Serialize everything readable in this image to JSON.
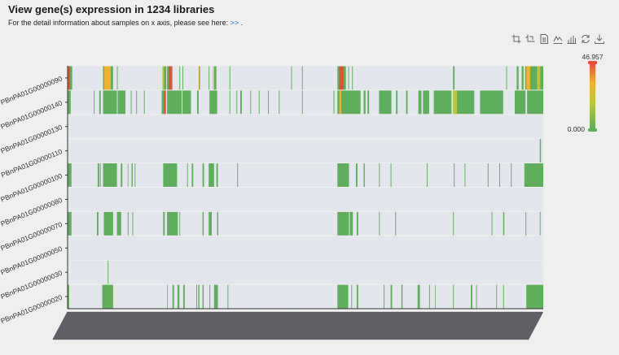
{
  "header": {
    "title": "View gene(s) expression in 1234 libraries",
    "subtitle_prefix": "For the detail information about samples on x axis, please see here:",
    "link_text": ">>",
    "subtitle_suffix": "."
  },
  "toolbar": {
    "tools": [
      {
        "icon": "crop-icon"
      },
      {
        "icon": "crop-reset-icon"
      },
      {
        "icon": "data-view-icon"
      },
      {
        "icon": "line-chart-icon"
      },
      {
        "icon": "bar-chart-icon"
      },
      {
        "icon": "refresh-icon"
      },
      {
        "icon": "download-icon"
      }
    ]
  },
  "chart_data": {
    "type": "heatmap",
    "title": "View gene(s) expression in 1234 libraries",
    "n_samples": 1234,
    "rows": [
      "PBnPA01G00000020",
      "PBnPA01G00000030",
      "PBnPA01G00000050",
      "PBnPA01G00000070",
      "PBnPA01G00000080",
      "PBnPA01G00000100",
      "PBnPA01G00000110",
      "PBnPA01G00000130",
      "PBnPA01G00000140",
      "PBnPA01G00000090"
    ],
    "colorbar": {
      "min": 0.0,
      "max": 46.957,
      "min_label": "0.000",
      "max_label": "46.957"
    },
    "colors": {
      "empty": "#e3e6ec",
      "low": "#5fae5c",
      "mid": "#bcc63a",
      "high_mid": "#f0b22e",
      "high": "#ea4c34"
    },
    "expressed_segments": {
      "PBnPA01G00000020": [
        [
          0,
          4
        ],
        [
          90,
          118
        ],
        [
          258,
          259
        ],
        [
          272,
          276
        ],
        [
          285,
          290
        ],
        [
          300,
          304
        ],
        [
          334,
          336
        ],
        [
          339,
          342
        ],
        [
          350,
          353
        ],
        [
          368,
          370
        ],
        [
          380,
          390
        ],
        [
          415,
          417
        ],
        [
          700,
          728
        ],
        [
          736,
          738
        ],
        [
          750,
          754
        ],
        [
          820,
          822
        ],
        [
          838,
          842
        ],
        [
          866,
          869
        ],
        [
          908,
          914
        ],
        [
          938,
          940
        ],
        [
          953,
          954
        ],
        [
          1000,
          1002
        ],
        [
          1046,
          1050
        ],
        [
          1060,
          1062
        ],
        [
          1112,
          1114
        ],
        [
          1130,
          1132
        ],
        [
          1190,
          1234
        ]
      ],
      "PBnPA01G00000030": [
        [
          104,
          106
        ]
      ],
      "PBnPA01G00000050": [],
      "PBnPA01G00000070": [
        [
          0,
          10
        ],
        [
          76,
          80
        ],
        [
          94,
          118
        ],
        [
          128,
          139
        ],
        [
          156,
          158
        ],
        [
          168,
          170
        ],
        [
          248,
          252
        ],
        [
          258,
          286
        ],
        [
          290,
          292
        ],
        [
          350,
          353
        ],
        [
          366,
          374
        ],
        [
          388,
          391
        ],
        [
          700,
          730
        ],
        [
          732,
          740
        ],
        [
          750,
          754
        ],
        [
          808,
          810
        ],
        [
          850,
          852
        ],
        [
          1000,
          1002
        ],
        [
          1100,
          1102
        ],
        [
          1130,
          1133
        ],
        [
          1188,
          1190
        ],
        [
          1225,
          1227
        ]
      ],
      "PBnPA01G00000080": [],
      "PBnPA01G00000100": [
        [
          0,
          10
        ],
        [
          78,
          82
        ],
        [
          84,
          86
        ],
        [
          92,
          128
        ],
        [
          138,
          142
        ],
        [
          156,
          157
        ],
        [
          166,
          169
        ],
        [
          174,
          176
        ],
        [
          248,
          284
        ],
        [
          310,
          312
        ],
        [
          322,
          326
        ],
        [
          350,
          354
        ],
        [
          366,
          380
        ],
        [
          386,
          390
        ],
        [
          440,
          442
        ],
        [
          700,
          730
        ],
        [
          748,
          752
        ],
        [
          768,
          771
        ],
        [
          808,
          810
        ],
        [
          838,
          840
        ],
        [
          932,
          934
        ],
        [
          1002,
          1004
        ],
        [
          1030,
          1032
        ],
        [
          1090,
          1092
        ],
        [
          1120,
          1122
        ],
        [
          1150,
          1152
        ],
        [
          1185,
          1234
        ]
      ],
      "PBnPA01G00000110": [
        [
          1225,
          1228
        ]
      ],
      "PBnPA01G00000130": [],
      "PBnPA01G00000140": [
        [
          0,
          8
        ],
        [
          68,
          70
        ],
        [
          82,
          86
        ],
        [
          92,
          128
        ],
        [
          130,
          150
        ],
        [
          164,
          166
        ],
        [
          178,
          180
        ],
        [
          198,
          200
        ],
        [
          244,
          255
        ],
        [
          258,
          296
        ],
        [
          298,
          320
        ],
        [
          336,
          340
        ],
        [
          368,
          388
        ],
        [
          420,
          422
        ],
        [
          438,
          440
        ],
        [
          448,
          452
        ],
        [
          474,
          476
        ],
        [
          496,
          498
        ],
        [
          520,
          522
        ],
        [
          548,
          550
        ],
        [
          608,
          610
        ],
        [
          690,
          692
        ],
        [
          700,
          760
        ],
        [
          768,
          773
        ],
        [
          778,
          782
        ],
        [
          808,
          840
        ],
        [
          852,
          856
        ],
        [
          878,
          882
        ],
        [
          910,
          918
        ],
        [
          922,
          938
        ],
        [
          950,
          996
        ],
        [
          1000,
          1055
        ],
        [
          1070,
          1130
        ],
        [
          1160,
          1188
        ],
        [
          1192,
          1234
        ]
      ],
      "PBnPA01G00000090": [
        [
          0,
          12
        ],
        [
          92,
          118
        ],
        [
          128,
          130
        ],
        [
          248,
          256
        ],
        [
          258,
          272
        ],
        [
          290,
          292
        ],
        [
          298,
          300
        ],
        [
          340,
          344
        ],
        [
          366,
          368
        ],
        [
          380,
          386
        ],
        [
          420,
          422
        ],
        [
          580,
          582
        ],
        [
          608,
          610
        ],
        [
          700,
          722
        ],
        [
          728,
          730
        ],
        [
          738,
          740
        ],
        [
          1000,
          1004
        ],
        [
          1138,
          1140
        ],
        [
          1165,
          1170
        ],
        [
          1178,
          1183
        ],
        [
          1187,
          1234
        ]
      ]
    },
    "high_segments": {
      "PBnPA01G00000090": [
        [
          0,
          6
        ],
        [
          95,
          112
        ],
        [
          246,
          250
        ],
        [
          262,
          270
        ],
        [
          341,
          343
        ],
        [
          377,
          379
        ],
        [
          705,
          716
        ],
        [
          1190,
          1200
        ],
        [
          1218,
          1226
        ]
      ],
      "PBnPA01G00000140": [
        [
          250,
          255
        ],
        [
          705,
          710
        ],
        [
          1000,
          1010
        ]
      ]
    }
  }
}
